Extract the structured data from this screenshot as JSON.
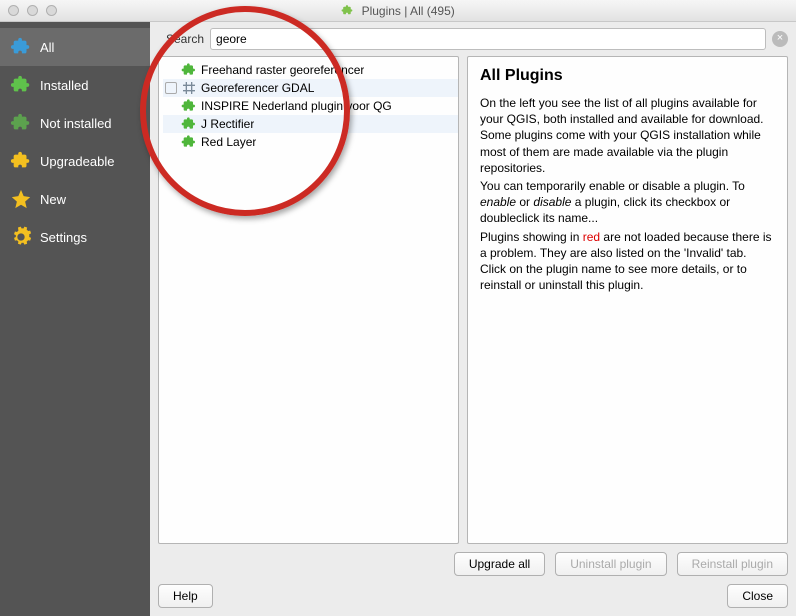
{
  "window": {
    "title": "Plugins | All (495)"
  },
  "search": {
    "label": "Search",
    "value": "geore"
  },
  "sidebar": {
    "items": [
      {
        "label": "All"
      },
      {
        "label": "Installed"
      },
      {
        "label": "Not installed"
      },
      {
        "label": "Upgradeable"
      },
      {
        "label": "New"
      },
      {
        "label": "Settings"
      }
    ]
  },
  "pluginList": {
    "items": [
      {
        "name": "Freehand raster georeferencer",
        "checkbox": false,
        "selected": false,
        "iconColor": "#4fb63b"
      },
      {
        "name": "Georeferencer GDAL",
        "checkbox": true,
        "selected": true,
        "iconColor": "#7a8a99",
        "iconType": "grid"
      },
      {
        "name": "INSPIRE Nederland plugin voor QG",
        "checkbox": false,
        "selected": false,
        "iconColor": "#4fb63b"
      },
      {
        "name": "J Rectifier",
        "checkbox": false,
        "selected": true,
        "iconColor": "#4fb63b"
      },
      {
        "name": "Red Layer",
        "checkbox": false,
        "selected": false,
        "iconColor": "#4fb63b"
      }
    ]
  },
  "detail": {
    "heading": "All Plugins",
    "p1a": "On the left you see the list of all plugins available for your QGIS, both installed and available for download. Some plugins come with your QGIS installation while most of them are made available via the plugin repositories.",
    "p2a": "You can temporarily enable or disable a plugin. To ",
    "p2b": "enable",
    "p2c": " or ",
    "p2d": "disable",
    "p2e": " a plugin, click its checkbox or doubleclick its name...",
    "p3a": "Plugins showing in ",
    "p3b": "red",
    "p3c": " are not loaded because there is a problem. They are also listed on the 'Invalid' tab. Click on the plugin name to see more details, or to reinstall or uninstall this plugin."
  },
  "buttons": {
    "upgradeAll": "Upgrade all",
    "uninstall": "Uninstall plugin",
    "reinstall": "Reinstall plugin",
    "help": "Help",
    "close": "Close"
  }
}
